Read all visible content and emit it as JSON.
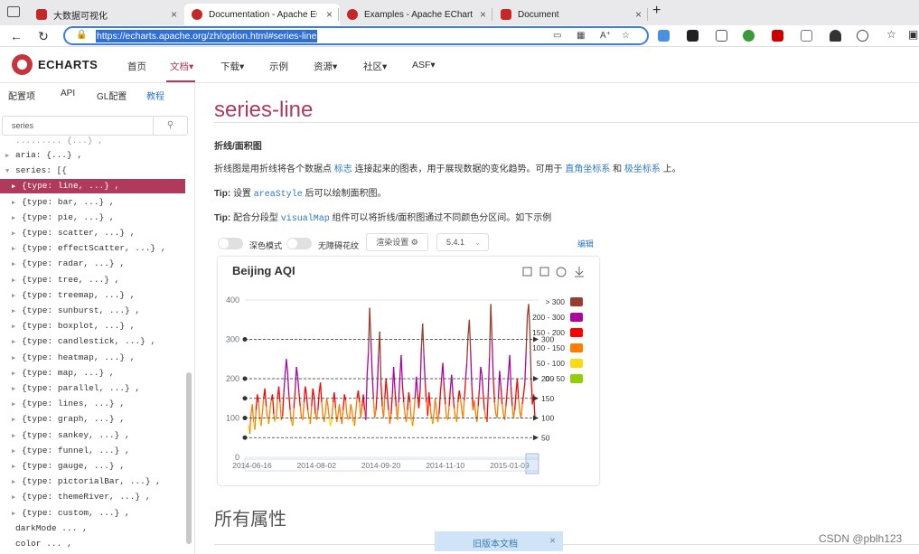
{
  "browser": {
    "tabs": [
      {
        "title": "大数据可视化",
        "fav_color": "#c62828"
      },
      {
        "title": "Documentation - Apache ECharts",
        "fav_color": "#c62828"
      },
      {
        "title": "Examples - Apache ECharts",
        "fav_color": "#c62828"
      },
      {
        "title": "Document",
        "fav_color": "#c62828"
      }
    ],
    "new_tab": "+",
    "tab_close": "×",
    "url": "https://echarts.apache.org/zh/option.html#series-line"
  },
  "site": {
    "logo_text": "ECHARTS",
    "nav": [
      "首页",
      "文档",
      "下载",
      "示例",
      "资源",
      "社区",
      "ASF"
    ],
    "active_nav": "文档",
    "colors": {
      "accent": "#b03a5b",
      "link": "#2f78c8"
    }
  },
  "sidebar": {
    "tabs": [
      "配置项",
      "API",
      "GL配置",
      "教程"
    ],
    "search_placeholder": "series",
    "tree": [
      {
        "text": "aria: {...} ,",
        "indent": 0,
        "arrow": "right"
      },
      {
        "text": "series: [{",
        "indent": 0,
        "arrow": "down"
      },
      {
        "text": "{type: line, ...} ,",
        "indent": 1,
        "arrow": "right",
        "selected": true
      },
      {
        "text": "{type: bar, ...} ,",
        "indent": 1,
        "arrow": "right"
      },
      {
        "text": "{type: pie, ...} ,",
        "indent": 1,
        "arrow": "right"
      },
      {
        "text": "{type: scatter, ...} ,",
        "indent": 1,
        "arrow": "right"
      },
      {
        "text": "{type: effectScatter, ...} ,",
        "indent": 1,
        "arrow": "right"
      },
      {
        "text": "{type: radar, ...} ,",
        "indent": 1,
        "arrow": "right"
      },
      {
        "text": "{type: tree, ...} ,",
        "indent": 1,
        "arrow": "right"
      },
      {
        "text": "{type: treemap, ...} ,",
        "indent": 1,
        "arrow": "right"
      },
      {
        "text": "{type: sunburst, ...} ,",
        "indent": 1,
        "arrow": "right"
      },
      {
        "text": "{type: boxplot, ...} ,",
        "indent": 1,
        "arrow": "right"
      },
      {
        "text": "{type: candlestick, ...} ,",
        "indent": 1,
        "arrow": "right"
      },
      {
        "text": "{type: heatmap, ...} ,",
        "indent": 1,
        "arrow": "right"
      },
      {
        "text": "{type: map, ...} ,",
        "indent": 1,
        "arrow": "right"
      },
      {
        "text": "{type: parallel, ...} ,",
        "indent": 1,
        "arrow": "right"
      },
      {
        "text": "{type: lines, ...} ,",
        "indent": 1,
        "arrow": "right"
      },
      {
        "text": "{type: graph, ...} ,",
        "indent": 1,
        "arrow": "right"
      },
      {
        "text": "{type: sankey, ...} ,",
        "indent": 1,
        "arrow": "right"
      },
      {
        "text": "{type: funnel, ...} ,",
        "indent": 1,
        "arrow": "right"
      },
      {
        "text": "{type: gauge, ...} ,",
        "indent": 1,
        "arrow": "right"
      },
      {
        "text": "{type: pictorialBar, ...} ,",
        "indent": 1,
        "arrow": "right"
      },
      {
        "text": "{type: themeRiver, ...} ,",
        "indent": 1,
        "arrow": "right"
      },
      {
        "text": "{type: custom, ...} ,",
        "indent": 1,
        "arrow": "right"
      },
      {
        "text": "darkMode ... ,",
        "indent": 0,
        "arrow": "none"
      },
      {
        "text": "color ... ,",
        "indent": 0,
        "arrow": "none"
      }
    ]
  },
  "content": {
    "title": "series-line",
    "subtitle": "折线/面积图",
    "desc_pre": "折线图是用折线将各个数据点",
    "desc_link1": "标志",
    "desc_mid": "连接起来的图表，用于展现数据的变化趋势。可用于",
    "desc_link2": "直角坐标系",
    "desc_and": "和",
    "desc_link3": "极坐标系",
    "desc_post": "上。",
    "tip_label": "Tip:",
    "tip1_pre": "设置",
    "tip1_code": "areaStyle",
    "tip1_post": "后可以绘制面积图。",
    "tip2_pre": "配合分段型",
    "tip2_code": "visualMap",
    "tip2_post": "组件可以将折线/面积图通过不同颜色分区间。如下示例",
    "toggle1": "深色模式",
    "toggle2": "无障碍花纹",
    "render_btn": "渲染设置 ⚙",
    "version": "5.4.1",
    "edit_link": "编辑",
    "section_title": "所有属性",
    "old_doc": "旧版本文档",
    "old_doc_close": "×",
    "watermark": "CSDN @pblh123"
  },
  "chart_data": {
    "type": "line",
    "title": "Beijing AQI",
    "ylim": [
      0,
      400
    ],
    "yticks": [
      0,
      100,
      200,
      300,
      400
    ],
    "xticks": [
      "2014-06-16",
      "2014-08-02",
      "2014-09-20",
      "2014-11-10",
      "2015-01-09"
    ],
    "markLines": [
      50,
      100,
      150,
      200,
      300
    ],
    "pieces": [
      {
        "label": "> 300",
        "color": "#993d2e"
      },
      {
        "label": "200 - 300",
        "color": "#aa069f"
      },
      {
        "label": "150 - 200",
        "color": "#fd0100"
      },
      {
        "label": "100 - 150",
        "color": "#fc7d02"
      },
      {
        "label": "50 - 100",
        "color": "#fbdb0f"
      },
      {
        "label": "0 - 50",
        "color": "#93ce07"
      }
    ],
    "values": [
      82,
      60,
      110,
      135,
      90,
      70,
      120,
      160,
      140,
      95,
      80,
      115,
      150,
      175,
      130,
      100,
      85,
      120,
      145,
      160,
      110,
      90,
      100,
      150,
      180,
      140,
      95,
      105,
      165,
      210,
      250,
      215,
      160,
      120,
      90,
      80,
      125,
      170,
      230,
      205,
      165,
      130,
      100,
      95,
      140,
      180,
      160,
      120,
      100,
      85,
      130,
      175,
      155,
      110,
      95,
      120,
      165,
      190,
      140,
      105,
      90,
      115,
      150,
      130,
      100,
      80,
      95,
      140,
      165,
      125,
      90,
      110,
      135,
      105,
      85,
      120,
      160,
      145,
      110,
      95,
      100,
      135,
      120,
      90,
      80,
      115,
      150,
      170,
      140,
      100,
      130,
      160,
      120,
      95,
      210,
      265,
      380,
      300,
      215,
      150,
      100,
      120,
      170,
      260,
      320,
      190,
      130,
      100,
      150,
      200,
      160,
      120,
      85,
      110,
      160,
      230,
      175,
      130,
      95,
      140,
      205,
      260,
      185,
      140,
      110,
      90,
      120,
      165,
      140,
      95,
      80,
      110,
      150,
      205,
      165,
      125,
      170,
      280,
      340,
      260,
      190,
      140,
      105,
      165,
      130,
      100,
      85,
      115,
      150,
      120,
      90,
      110,
      160,
      200,
      240,
      180,
      135,
      100,
      95,
      130,
      175,
      210,
      160,
      125,
      100,
      90,
      140,
      170,
      150,
      120,
      100,
      145,
      195,
      240,
      310,
      350,
      270,
      180,
      120,
      145,
      110,
      90,
      130,
      175,
      230,
      210,
      160,
      120,
      100,
      90,
      165,
      255,
      390,
      300,
      200,
      140,
      110,
      100,
      150,
      220,
      180,
      135,
      110,
      95,
      130,
      170,
      215,
      260,
      180,
      130,
      100,
      120,
      165,
      200,
      150,
      115,
      100,
      135,
      160,
      190,
      270,
      360,
      390,
      320,
      200,
      135,
      160,
      100
    ]
  }
}
